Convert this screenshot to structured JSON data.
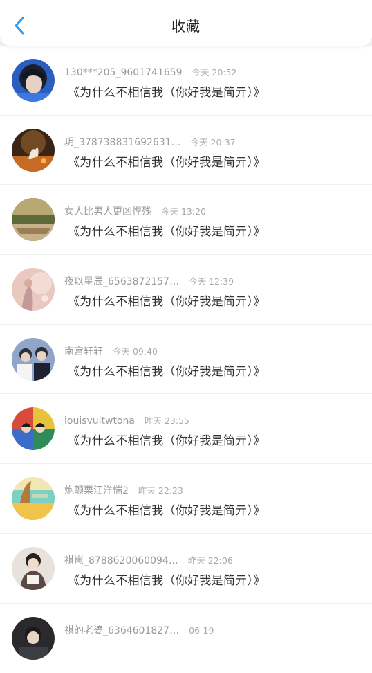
{
  "header": {
    "title": "收藏",
    "back_icon": "chevron-left-icon",
    "accent": "#2a9df4"
  },
  "items": [
    {
      "username": "130***205_9601741659",
      "time": "今天 20:52",
      "message": "《为什么不相信我（你好我是简亓）》"
    },
    {
      "username": "玥_378738831692631…",
      "time": "今天 20:37",
      "message": "《为什么不相信我（你好我是简亓）》"
    },
    {
      "username": "女人比男人更凶悍残",
      "time": "今天 13:20",
      "message": "《为什么不相信我（你好我是简亓）》"
    },
    {
      "username": "夜以星辰_6563872157…",
      "time": "今天 12:39",
      "message": "《为什么不相信我（你好我是简亓）》"
    },
    {
      "username": "南宫轩轩",
      "time": "今天 09:40",
      "message": "《为什么不相信我（你好我是简亓）》"
    },
    {
      "username": "louisvuitwtona",
      "time": "昨天 23:55",
      "message": "《为什么不相信我（你好我是简亓）》"
    },
    {
      "username": "炮颤栗汪洋惴2",
      "time": "昨天 22:23",
      "message": "《为什么不相信我（你好我是简亓）》"
    },
    {
      "username": "祺崽_8788620060094…",
      "time": "昨天 22:06",
      "message": "《为什么不相信我（你好我是简亓）》"
    },
    {
      "username": "祺的老婆_6364601827…",
      "time": "06-19",
      "message": ""
    }
  ]
}
